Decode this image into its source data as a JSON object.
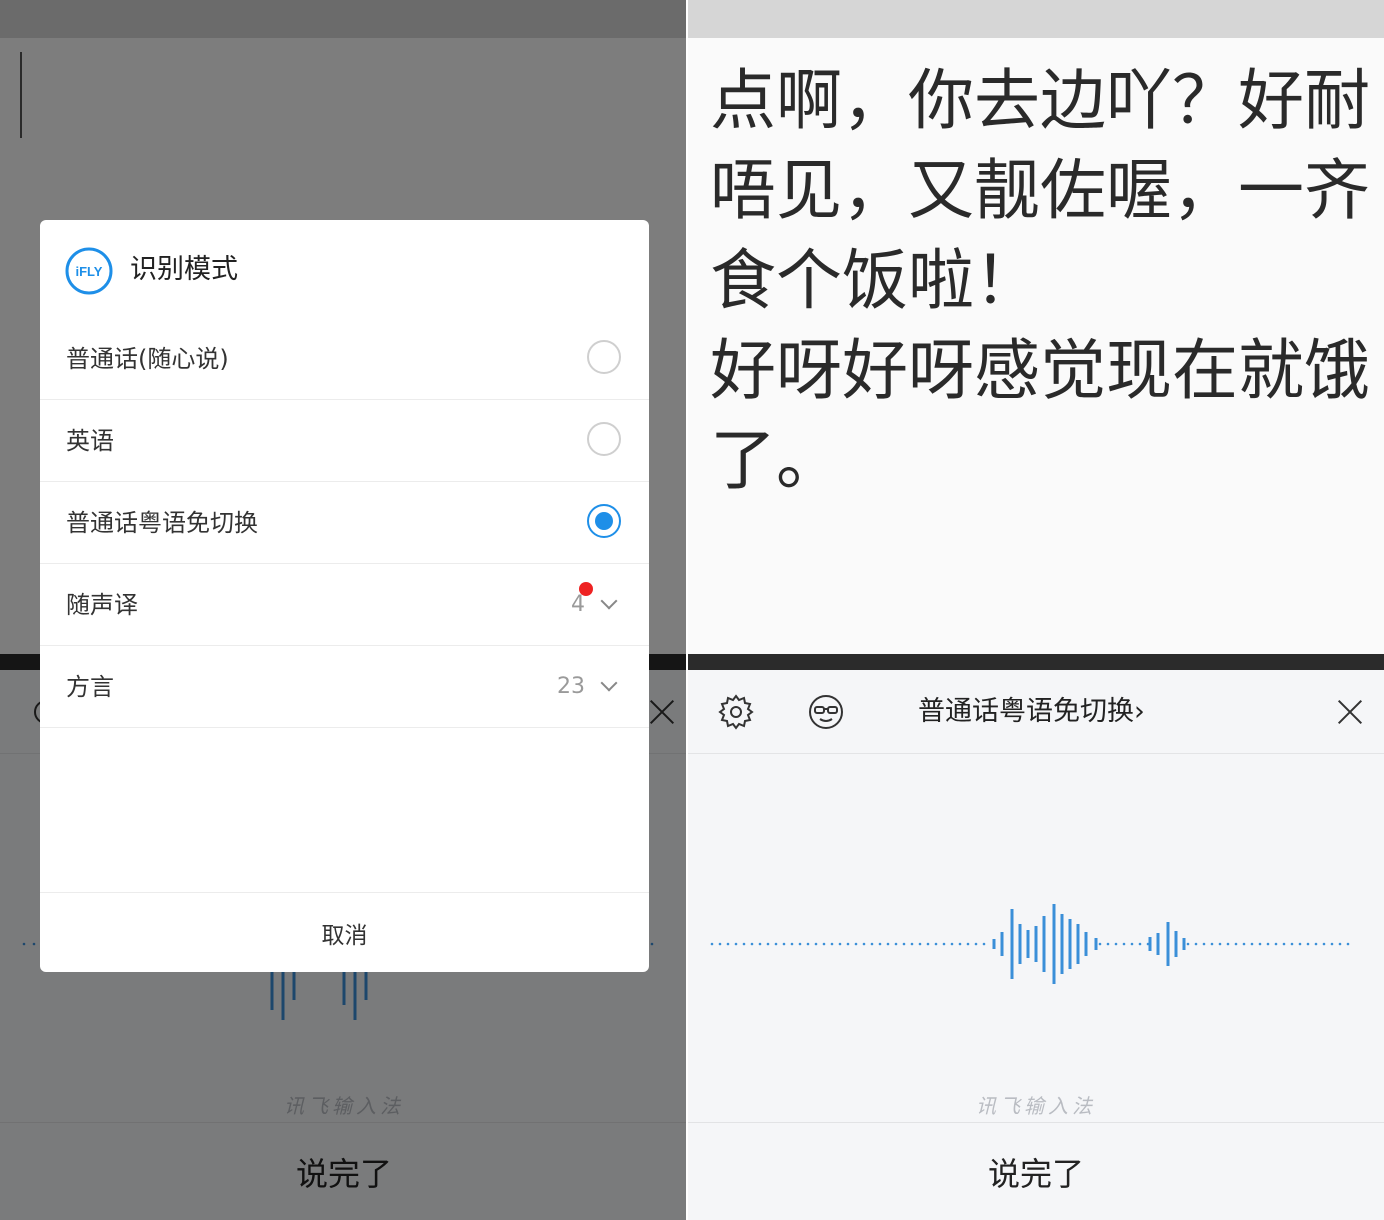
{
  "left": {
    "dialog": {
      "logo_text": "iFLY",
      "title": "识别模式",
      "options": [
        {
          "label": "普通话(随心说)",
          "selected": false
        },
        {
          "label": "英语",
          "selected": false
        },
        {
          "label": "普通话粤语免切换",
          "selected": true
        }
      ],
      "translate": {
        "label": "随声译",
        "count": "4"
      },
      "dialect": {
        "label": "方言",
        "count": "23"
      },
      "cancel_label": "取消"
    },
    "keyboard": {
      "brand": "讯飞输入法",
      "done_label": "说完了"
    }
  },
  "right": {
    "document": {
      "lines": [
        "点啊，你去边吖？好耐",
        "唔见，又靓佐喔，一齐",
        "食个饭啦！",
        "好呀好呀感觉现在就饿",
        "了。"
      ]
    },
    "keyboard": {
      "settings_icon": "gear-icon",
      "face_icon": "glasses-face-icon",
      "mode_label": "普通话粤语免切换›",
      "close_icon": "close-icon",
      "brand": "讯飞输入法",
      "done_label": "说完了"
    }
  },
  "colors": {
    "accent": "#1e8fe8",
    "wave": "#3a8fd8",
    "badge": "#ee2222"
  }
}
